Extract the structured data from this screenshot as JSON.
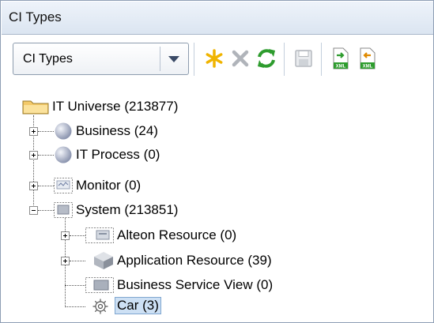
{
  "panel": {
    "title": "CI Types"
  },
  "toolbar": {
    "combo_value": "CI Types",
    "buttons": [
      "new-icon",
      "delete-icon",
      "refresh-icon",
      "save-icon",
      "import-xml-icon",
      "export-xml-icon"
    ]
  },
  "tree": {
    "root": {
      "label": "IT Universe (213877)",
      "icon": "folder-icon"
    },
    "items": [
      {
        "label": "Business (24)",
        "icon": "sphere-icon",
        "expander": "plus"
      },
      {
        "label": "IT Process (0)",
        "icon": "sphere-icon",
        "expander": "plus"
      },
      {
        "label": "Monitor (0)",
        "icon": "monitor-icon",
        "expander": "plus"
      },
      {
        "label": "System (213851)",
        "icon": "system-icon",
        "expander": "minus"
      },
      {
        "label": "Alteon Resource (0)",
        "icon": "alteon-icon",
        "expander": "plus"
      },
      {
        "label": "Application Resource (39)",
        "icon": "cube-icon",
        "expander": "plus"
      },
      {
        "label": "Business Service View (0)",
        "icon": "service-view-icon",
        "expander": "none"
      },
      {
        "label": "Car (3)",
        "icon": "gear-icon",
        "expander": "none",
        "selected": true
      }
    ]
  },
  "colors": {
    "selection": "#cde0f4",
    "header": "#dbe5f1",
    "refresh": "#2e9c2e",
    "new": "#f0b400"
  }
}
